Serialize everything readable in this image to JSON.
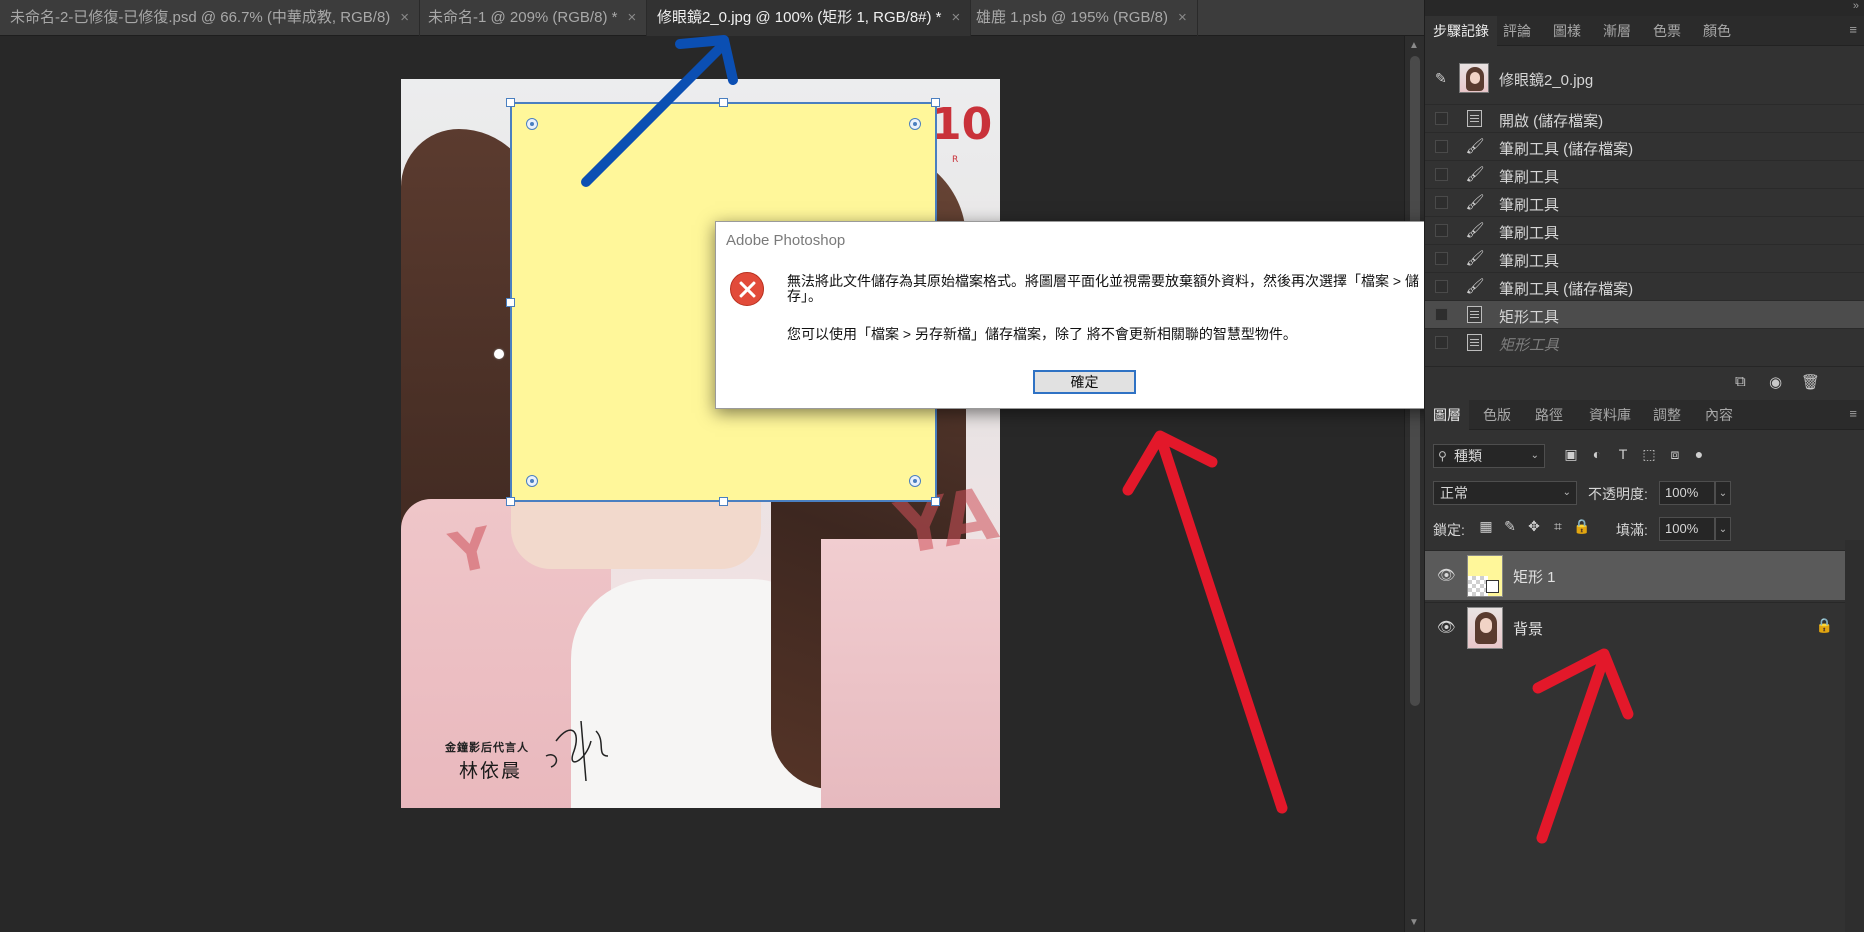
{
  "document_tabs": [
    {
      "label": "未命名-2-已修復-已修復.psd @ 66.7% (中華成教, RGB/8)",
      "active": false
    },
    {
      "label": "未命名-1 @ 209% (RGB/8) *",
      "active": false
    },
    {
      "label": "修眼鏡2_0.jpg @ 100% (矩形 1, RGB/8#) *",
      "active": true
    },
    {
      "label": "雄鹿 1.psb @ 195% (RGB/8)",
      "active": false
    }
  ],
  "tab_close_glyph": "×",
  "canvas": {
    "artwork_text": {
      "ten": "10",
      "r": "R",
      "ya": "YA",
      "y": "Y",
      "caption_small": "金鐘影后代言人",
      "caption_name": "林依晨"
    },
    "shape_fill_color": "#fff79a"
  },
  "dialog": {
    "title": "Adobe Photoshop",
    "message_1": "無法將此文件儲存為其原始檔案格式。將圖層平面化並視需要放棄額外資料，然後再次選擇「檔案 > 儲存」。",
    "message_2": "您可以使用「檔案 > 另存新檔」儲存檔案，除了 將不會更新相關聯的智慧型物件。",
    "ok_label": "確定",
    "icon": "error-icon"
  },
  "history_panel": {
    "tabs": [
      "步驟記錄",
      "評論",
      "圖樣",
      "漸層",
      "色票",
      "顏色"
    ],
    "active_tab": 0,
    "source_label": "修眼鏡2_0.jpg",
    "steps": [
      {
        "label": "開啟 (儲存檔案)",
        "icon": "document-icon",
        "state": "normal"
      },
      {
        "label": "筆刷工具 (儲存檔案)",
        "icon": "brush-icon",
        "state": "normal"
      },
      {
        "label": "筆刷工具",
        "icon": "brush-icon",
        "state": "normal"
      },
      {
        "label": "筆刷工具",
        "icon": "brush-icon",
        "state": "normal"
      },
      {
        "label": "筆刷工具",
        "icon": "brush-icon",
        "state": "normal"
      },
      {
        "label": "筆刷工具",
        "icon": "brush-icon",
        "state": "normal"
      },
      {
        "label": "筆刷工具 (儲存檔案)",
        "icon": "brush-icon",
        "state": "normal"
      },
      {
        "label": "矩形工具",
        "icon": "document-icon",
        "state": "selected"
      },
      {
        "label": "矩形工具",
        "icon": "document-icon",
        "state": "undone"
      }
    ],
    "footer_icons": [
      "new-document-from-state-icon",
      "camera-icon",
      "trash-icon"
    ]
  },
  "layers_panel": {
    "tabs": [
      "圖層",
      "色版",
      "路徑",
      "資料庫",
      "調整",
      "內容"
    ],
    "active_tab": 0,
    "kind_filter": "種類",
    "filter_icons": [
      "image-filter-icon",
      "adjustment-filter-icon",
      "type-filter-icon",
      "shape-filter-icon",
      "smart-object-filter-icon",
      "filter-toggle-icon"
    ],
    "blend_mode": "正常",
    "opacity_label": "不透明度:",
    "opacity_value": "100%",
    "lock_label": "鎖定:",
    "lock_icons": [
      "lock-transparent-icon",
      "lock-paint-icon",
      "lock-position-icon",
      "lock-artboard-icon",
      "lock-all-icon"
    ],
    "fill_label": "填滿:",
    "fill_value": "100%",
    "layers": [
      {
        "name": "矩形 1",
        "visible": true,
        "selected": true,
        "locked": false
      },
      {
        "name": "背景",
        "visible": true,
        "selected": false,
        "locked": true
      }
    ]
  },
  "colors": {
    "annotation_blue": "#0b4fb3",
    "annotation_red": "#e3182a",
    "selection_blue": "#4a7fc0",
    "panel_bg": "#323232"
  }
}
